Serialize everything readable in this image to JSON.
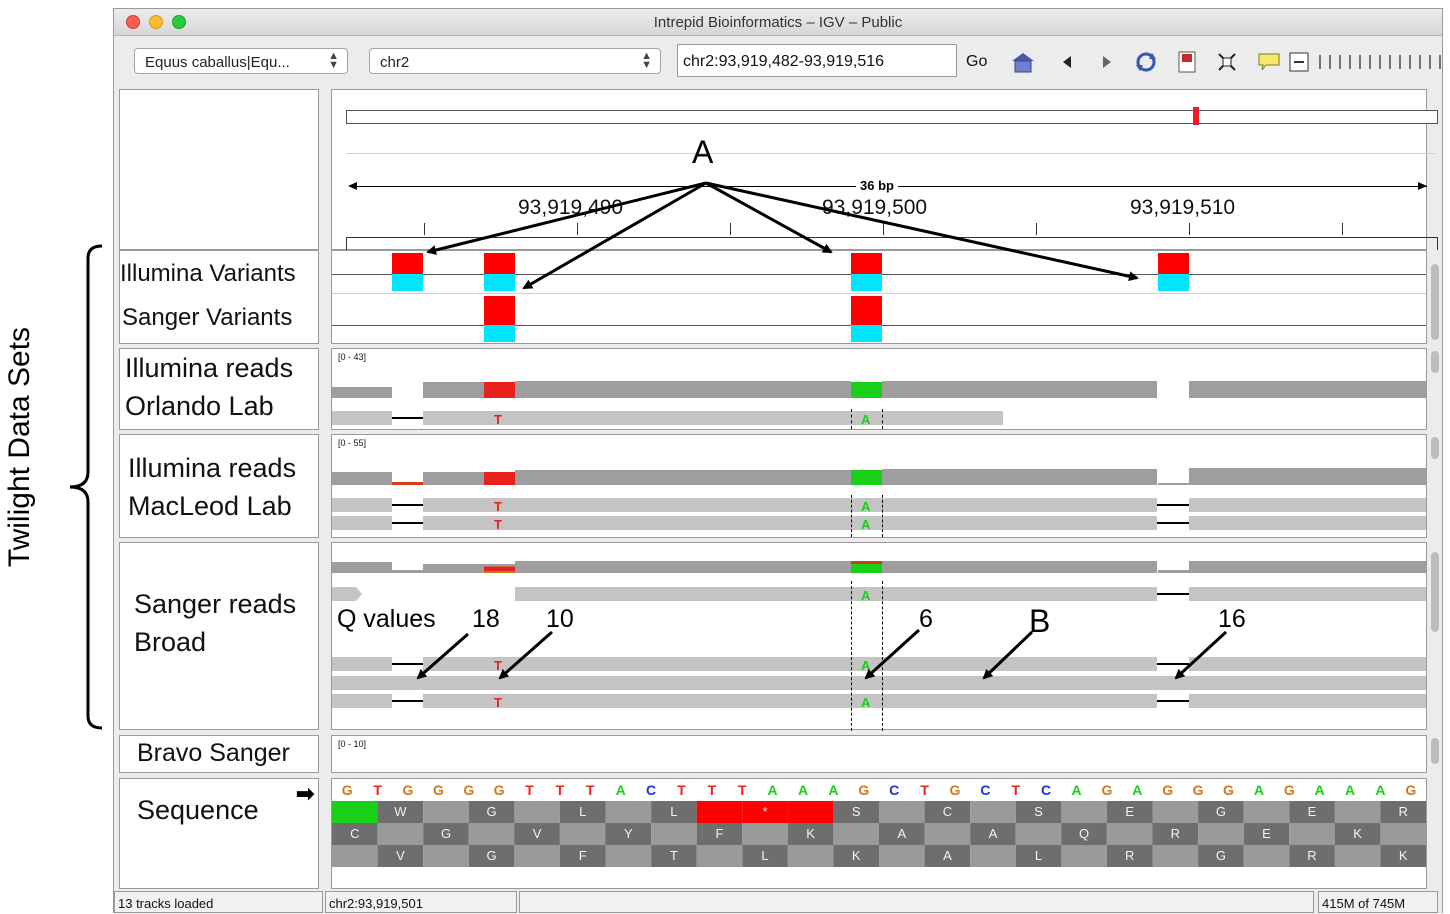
{
  "figure": {
    "side_label": "Twilight Data Sets"
  },
  "window": {
    "title": "Intrepid Bioinformatics – IGV – Public"
  },
  "toolbar": {
    "genome_select": "Equus caballus|Equ...",
    "chromosome_select": "chr2",
    "locus_input": "chr2:93,919,482-93,919,516",
    "go_label": "Go"
  },
  "ruler": {
    "span_label": "36 bp",
    "ticks": [
      "93,919,490",
      "93,919,500",
      "93,919,510"
    ]
  },
  "tracks": {
    "illumina_variants": "Illumina Variants",
    "sanger_variants": "Sanger Variants",
    "illumina_orlando_line1": "Illumina reads",
    "illumina_orlando_line2": "Orlando Lab",
    "illumina_orlando_range": "[0 - 43]",
    "illumina_macleod_line1": "Illumina reads",
    "illumina_macleod_line2": "MacLeod Lab",
    "illumina_macleod_range": "[0 - 55]",
    "sanger_broad_line1": "Sanger reads",
    "sanger_broad_line2": "Broad",
    "bravo_sanger": "Bravo Sanger",
    "bravo_range": "[0 - 10]",
    "sequence": "Sequence"
  },
  "annotations": {
    "a": "A",
    "b": "B",
    "q_values": "Q values",
    "q18": "18",
    "q10": "10",
    "q6": "6",
    "q16": "16"
  },
  "read_bases": {
    "t": "T",
    "a": "A"
  },
  "sequence": {
    "bases": [
      "G",
      "T",
      "G",
      "G",
      "G",
      "G",
      "T",
      "T",
      "T",
      "A",
      "C",
      "T",
      "T",
      "T",
      "A",
      "A",
      "A",
      "G",
      "C",
      "T",
      "G",
      "C",
      "T",
      "C",
      "A",
      "G",
      "A",
      "G",
      "G",
      "G",
      "A",
      "G",
      "A",
      "A",
      "A",
      "G"
    ],
    "frame1": [
      "",
      "W",
      "",
      "G",
      "",
      "L",
      "",
      "L",
      "",
      "*",
      "",
      "S",
      "",
      "C",
      "",
      "S",
      "",
      "E",
      "",
      "G",
      "",
      "E",
      "",
      "R"
    ],
    "frame2": [
      "C",
      "",
      "G",
      "",
      "V",
      "",
      "Y",
      "",
      "F",
      "",
      "K",
      "",
      "A",
      "",
      "A",
      "",
      "Q",
      "",
      "R",
      "",
      "E",
      "",
      "K",
      ""
    ],
    "frame3": [
      "",
      "V",
      "",
      "G",
      "",
      "F",
      "",
      "T",
      "",
      "L",
      "",
      "K",
      "",
      "A",
      "",
      "L",
      "",
      "R",
      "",
      "G",
      "",
      "R",
      "",
      "K"
    ]
  },
  "status": {
    "tracks_loaded": "13 tracks loaded",
    "position": "chr2:93,919,501",
    "memory": "415M of 745M"
  },
  "colors": {
    "variant_red": "#ff0000",
    "variant_cyan": "#00e5ff",
    "mismatch_t": "#e8211c",
    "mismatch_a": "#19d019",
    "base_g": "#d1781a",
    "base_t": "#e8211c",
    "base_a": "#19d019",
    "base_c": "#1a30d9"
  }
}
